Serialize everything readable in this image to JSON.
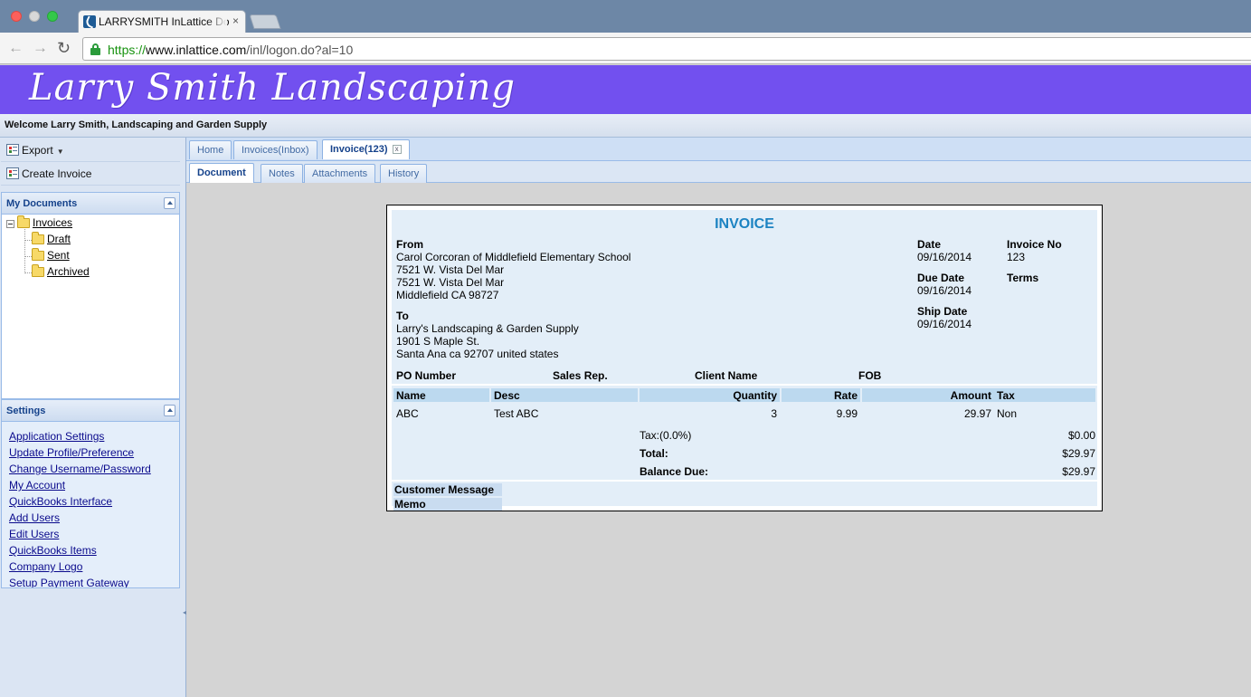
{
  "browser": {
    "tab_title": "LARRYSMITH InLattice Do",
    "tab_close": "×",
    "nav_back": "←",
    "nav_forward": "→",
    "nav_reload": "↻",
    "url_protocol": "https://",
    "url_host": "www.inlattice.com",
    "url_path": "/inl/logon.do?al=10"
  },
  "app": {
    "banner_title": "Larry Smith Landscaping",
    "banner_color": "#7250ef",
    "welcome": "Welcome Larry Smith, Landscaping and Garden Supply"
  },
  "sidebar": {
    "actions": [
      {
        "label": "Export",
        "caret": "▼"
      },
      {
        "label": "Create Invoice"
      }
    ],
    "my_documents": {
      "title": "My Documents",
      "root": "Invoices",
      "children": [
        "Draft",
        "Sent",
        "Archived"
      ]
    },
    "settings": {
      "title": "Settings",
      "links": [
        "Application Settings",
        "Update Profile/Preference",
        "Change Username/Password",
        "My Account",
        "QuickBooks Interface",
        "Add Users",
        "Edit Users",
        "QuickBooks Items",
        "Company Logo",
        "Setup Payment Gateway"
      ]
    },
    "splitter_glyph": "◂"
  },
  "tabs": {
    "main": [
      {
        "label": "Home"
      },
      {
        "label": "Invoices(Inbox)"
      },
      {
        "label": "Invoice(123)",
        "close": "x"
      }
    ],
    "sub": [
      {
        "label": "Document"
      },
      {
        "label": "Notes"
      },
      {
        "label": "Attachments"
      },
      {
        "label": "History"
      }
    ]
  },
  "invoice": {
    "title": "INVOICE",
    "from_label": "From",
    "from_lines": [
      "Carol Corcoran of Middlefield Elementary School",
      "7521 W. Vista Del Mar",
      "7521 W. Vista Del Mar",
      "Middlefield CA 98727"
    ],
    "to_label": "To",
    "to_lines": [
      "Larry's Landscaping & Garden Supply",
      "1901 S Maple St.",
      "Santa Ana  ca 92707 united states"
    ],
    "date_label": "Date",
    "date": "09/16/2014",
    "invoice_no_label": "Invoice No",
    "invoice_no": "123",
    "due_date_label": "Due Date",
    "due_date": "09/16/2014",
    "terms_label": "Terms",
    "ship_date_label": "Ship Date",
    "ship_date": "09/16/2014",
    "po_number_label": "PO Number",
    "sales_rep_label": "Sales Rep.",
    "client_name_label": "Client Name",
    "fob_label": "FOB",
    "columns": {
      "name": "Name",
      "desc": "Desc",
      "quantity": "Quantity",
      "rate": "Rate",
      "amount": "Amount",
      "tax": "Tax"
    },
    "lines": [
      {
        "name": "ABC",
        "desc": "Test ABC",
        "quantity": "3",
        "rate": "9.99",
        "amount": "29.97",
        "tax": "Non"
      }
    ],
    "tax_label": "Tax:(0.0%)",
    "tax_value": "$0.00",
    "total_label": "Total:",
    "total_value": "$29.97",
    "balance_label": "Balance Due:",
    "balance_value": "$29.97",
    "customer_message_label": "Customer Message",
    "memo_label": "Memo"
  }
}
